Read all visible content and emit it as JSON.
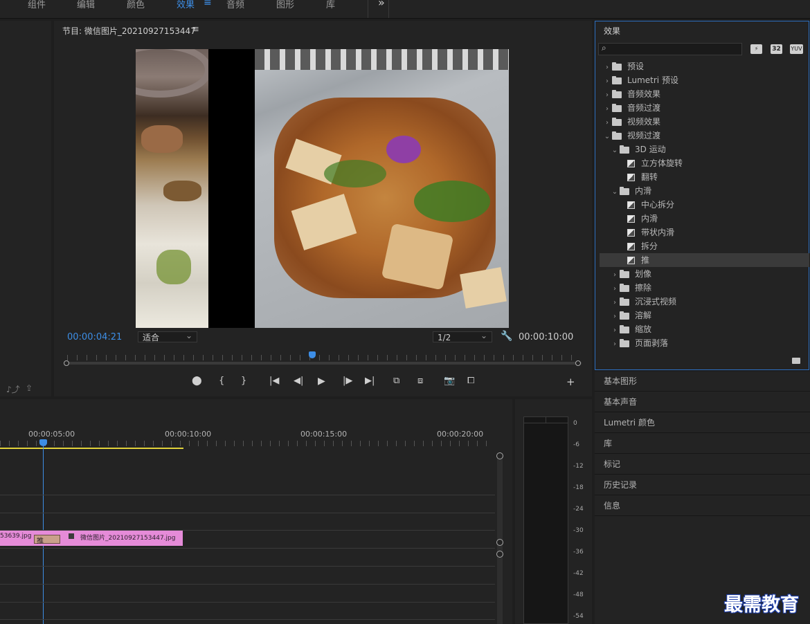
{
  "workspace_tabs": [
    {
      "label": "组件",
      "active": false
    },
    {
      "label": "编辑",
      "active": false
    },
    {
      "label": "颜色",
      "active": false
    },
    {
      "label": "效果",
      "active": true
    },
    {
      "label": "音频",
      "active": false
    },
    {
      "label": "图形",
      "active": false
    },
    {
      "label": "库",
      "active": false
    }
  ],
  "workspace_menu_glyph": "≡",
  "overflow_glyph": "»",
  "program": {
    "title": "节目: 微信图片_20210927153447",
    "menu_glyph": "≡",
    "timecode_current": "00:00:04:21",
    "fit_label": "适合",
    "resolution_label": "1/2",
    "timecode_duration": "00:00:10:00"
  },
  "effects_panel": {
    "title": "效果",
    "badges": [
      "32",
      "YUV"
    ],
    "tree": [
      {
        "label": "预设",
        "indent": 0,
        "kind": "folder-special",
        "chevron": "›",
        "selected": false
      },
      {
        "label": "Lumetri 预设",
        "indent": 0,
        "kind": "folder-special",
        "chevron": "›",
        "selected": false
      },
      {
        "label": "音频效果",
        "indent": 0,
        "kind": "folder",
        "chevron": "›",
        "selected": false
      },
      {
        "label": "音频过渡",
        "indent": 0,
        "kind": "folder",
        "chevron": "›",
        "selected": false
      },
      {
        "label": "视频效果",
        "indent": 0,
        "kind": "folder",
        "chevron": "›",
        "selected": false
      },
      {
        "label": "视频过渡",
        "indent": 0,
        "kind": "folder",
        "chevron": "⌄",
        "selected": false
      },
      {
        "label": "3D 运动",
        "indent": 1,
        "kind": "folder",
        "chevron": "⌄",
        "selected": false
      },
      {
        "label": "立方体旋转",
        "indent": 2,
        "kind": "fx",
        "chevron": "",
        "selected": false
      },
      {
        "label": "翻转",
        "indent": 2,
        "kind": "fx",
        "chevron": "",
        "selected": false
      },
      {
        "label": "内滑",
        "indent": 1,
        "kind": "folder",
        "chevron": "⌄",
        "selected": false
      },
      {
        "label": "中心拆分",
        "indent": 2,
        "kind": "fx",
        "chevron": "",
        "selected": false
      },
      {
        "label": "内滑",
        "indent": 2,
        "kind": "fx",
        "chevron": "",
        "selected": false
      },
      {
        "label": "带状内滑",
        "indent": 2,
        "kind": "fx",
        "chevron": "",
        "selected": false
      },
      {
        "label": "拆分",
        "indent": 2,
        "kind": "fx",
        "chevron": "",
        "selected": false
      },
      {
        "label": "推",
        "indent": 2,
        "kind": "fx",
        "chevron": "",
        "selected": true
      },
      {
        "label": "划像",
        "indent": 1,
        "kind": "folder",
        "chevron": "›",
        "selected": false
      },
      {
        "label": "擦除",
        "indent": 1,
        "kind": "folder",
        "chevron": "›",
        "selected": false
      },
      {
        "label": "沉浸式视频",
        "indent": 1,
        "kind": "folder",
        "chevron": "›",
        "selected": false
      },
      {
        "label": "溶解",
        "indent": 1,
        "kind": "folder",
        "chevron": "›",
        "selected": false
      },
      {
        "label": "缩放",
        "indent": 1,
        "kind": "folder",
        "chevron": "›",
        "selected": false
      },
      {
        "label": "页面剥落",
        "indent": 1,
        "kind": "folder",
        "chevron": "›",
        "selected": false
      }
    ]
  },
  "right_stack": [
    "基本图形",
    "基本声音",
    "Lumetri 颜色",
    "库",
    "标记",
    "历史记录",
    "信息"
  ],
  "timeline": {
    "ruler_labels": [
      "00:00:05:00",
      "00:00:10:00",
      "00:00:15:00",
      "00:00:20:00"
    ],
    "clip_left_label": "53639.jpg",
    "transition_label": "推",
    "clip_right_label": "微信图片_20210927153447.jpg"
  },
  "meter_labels": [
    "0",
    "-6",
    "-12",
    "-18",
    "-24",
    "-30",
    "-36",
    "-42",
    "-48",
    "-54"
  ],
  "watermark": "最需教育",
  "colors": {
    "accent": "#3d8ee6",
    "clip": "#e58bd8",
    "transition": "#c9a08a",
    "selected_row": "#3a3a3a"
  }
}
